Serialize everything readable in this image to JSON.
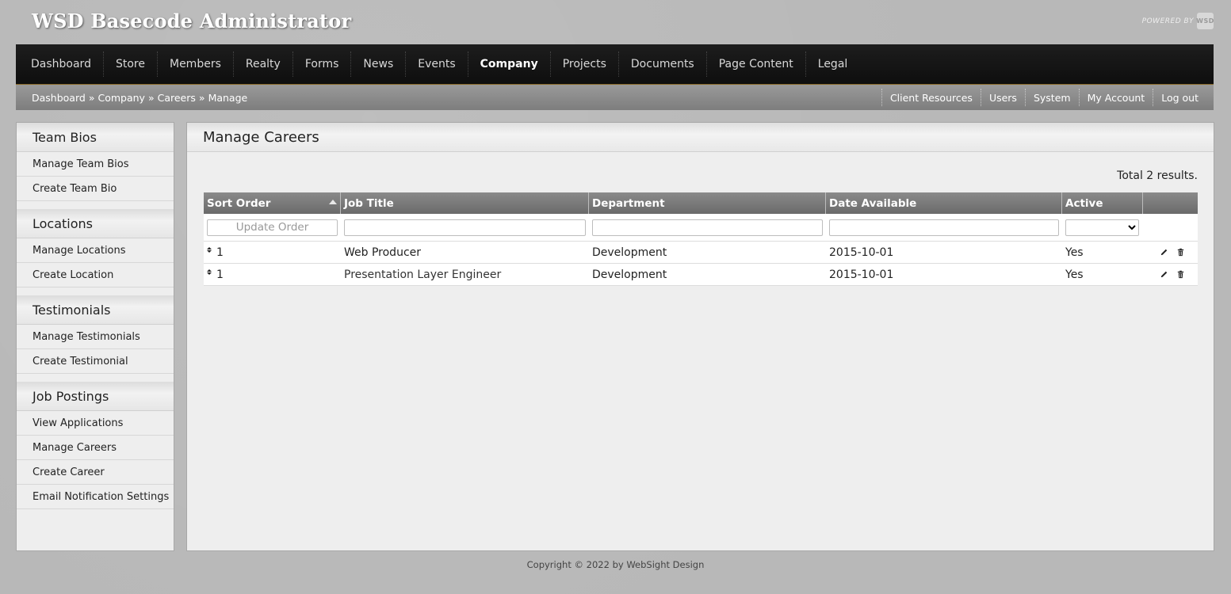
{
  "app": {
    "title": "WSD Basecode Administrator",
    "powered_by": "POWERED BY",
    "logo_text": "WSD"
  },
  "topnav": {
    "items": [
      "Dashboard",
      "Store",
      "Members",
      "Realty",
      "Forms",
      "News",
      "Events",
      "Company",
      "Projects",
      "Documents",
      "Page Content",
      "Legal"
    ],
    "active": "Company"
  },
  "breadcrumb": {
    "items": [
      "Dashboard",
      "Company",
      "Careers",
      "Manage"
    ],
    "separator": "»"
  },
  "utility_nav": [
    "Client Resources",
    "Users",
    "System",
    "My Account",
    "Log out"
  ],
  "sidebar": {
    "sections": [
      {
        "title": "Team Bios",
        "links": [
          "Manage Team Bios",
          "Create Team Bio"
        ]
      },
      {
        "title": "Locations",
        "links": [
          "Manage Locations",
          "Create Location"
        ]
      },
      {
        "title": "Testimonials",
        "links": [
          "Manage Testimonials",
          "Create Testimonial"
        ]
      },
      {
        "title": "Job Postings",
        "links": [
          "View Applications",
          "Manage Careers",
          "Create Career",
          "Email Notification Settings"
        ]
      }
    ]
  },
  "main": {
    "title": "Manage Careers",
    "total": "Total 2 results.",
    "columns": [
      "Sort Order",
      "Job Title",
      "Department",
      "Date Available",
      "Active",
      ""
    ],
    "sorted_column": "Sort Order",
    "filters": {
      "sort_order_placeholder": "Update Order",
      "job_title": "",
      "department": "",
      "date_available": "",
      "active_selected": ""
    },
    "rows": [
      {
        "sort_order": "1",
        "job_title": "Web Producer",
        "department": "Development",
        "date_available": "2015-10-01",
        "active": "Yes"
      },
      {
        "sort_order": "1",
        "job_title": "Presentation Layer Engineer",
        "department": "Development",
        "date_available": "2015-10-01",
        "active": "Yes"
      }
    ]
  },
  "footer": {
    "copyright": "Copyright © 2022 by WebSight Design"
  },
  "colors": {
    "nav_bg": "#141414",
    "subbar_bg": "#8c8c8c",
    "page_bg": "#b8b8b8",
    "panel_bg": "#eeeeee",
    "grid_header_bg": "#7a7a7a"
  }
}
